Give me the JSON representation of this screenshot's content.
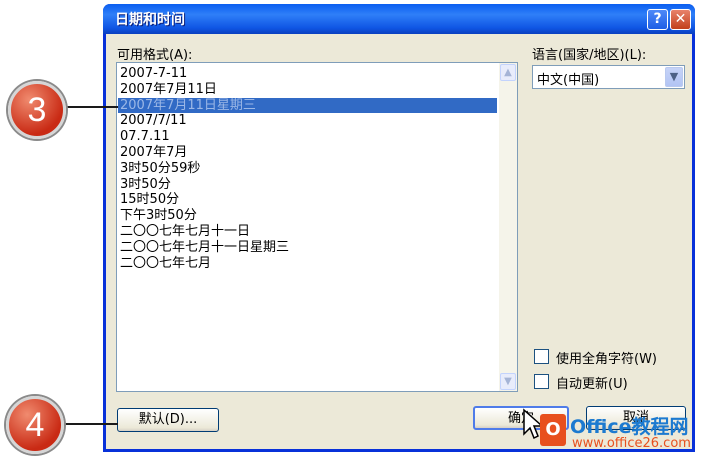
{
  "dialog": {
    "title": "日期和时间",
    "help_label": "?",
    "close_label": "✕"
  },
  "formats": {
    "label": "可用格式(A):",
    "items": [
      "2007-7-11",
      "2007年7月11日",
      "2007年7月11日星期三",
      "2007/7/11",
      "07.7.11",
      "2007年7月",
      "3时50分59秒",
      "3时50分",
      "15时50分",
      "下午3时50分",
      "二〇〇七年七月十一日",
      "二〇〇七年七月十一日星期三",
      "二〇〇七年七月"
    ],
    "selected_index": 2
  },
  "language": {
    "label": "语言(国家/地区)(L):",
    "value": "中文(中国)"
  },
  "options": {
    "fullwidth_label": "使用全角字符(W)",
    "autoupdate_label": "自动更新(U)"
  },
  "buttons": {
    "default_label": "默认(D)...",
    "ok_label": "确定",
    "cancel_label": "取消"
  },
  "annotations": {
    "marker_3": "3",
    "marker_4": "4"
  },
  "watermark": {
    "logo_letter": "O",
    "name": "Office教程网",
    "url": "www.office26.com"
  },
  "colors": {
    "titlebar": "#0a5ef0",
    "selection": "#316ac5",
    "dialog_bg": "#ece9d8",
    "marker": "#c92a14"
  }
}
